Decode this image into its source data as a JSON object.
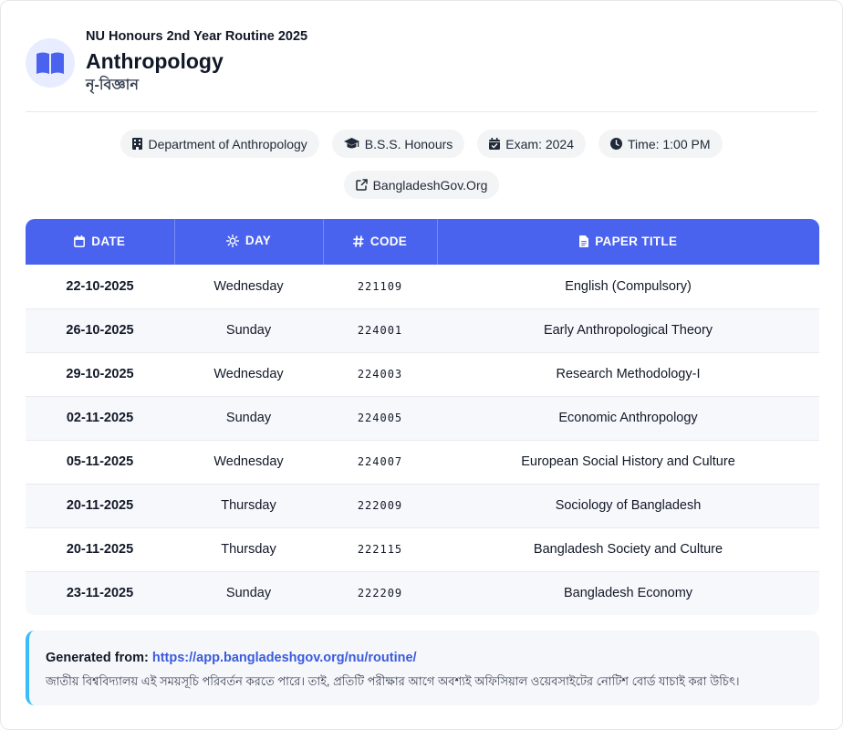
{
  "header": {
    "subtitle": "NU Honours 2nd Year Routine 2025",
    "title": "Anthropology",
    "bangla_title": "নৃ-বিজ্ঞান",
    "logo_icon": "book-open-icon"
  },
  "badges": [
    {
      "icon": "building-icon",
      "label": "Department of Anthropology"
    },
    {
      "icon": "graduation-cap-icon",
      "label": "B.S.S. Honours"
    },
    {
      "icon": "calendar-check-icon",
      "label": "Exam: 2024"
    },
    {
      "icon": "clock-icon",
      "label": "Time: 1:00 PM"
    },
    {
      "icon": "external-link-icon",
      "label": "BangladeshGov.Org"
    }
  ],
  "table": {
    "headers": {
      "date": "DATE",
      "day": "DAY",
      "code": "CODE",
      "title": "PAPER TITLE"
    },
    "rows": [
      {
        "date": "22-10-2025",
        "day": "Wednesday",
        "code": "221109",
        "title": "English (Compulsory)"
      },
      {
        "date": "26-10-2025",
        "day": "Sunday",
        "code": "224001",
        "title": "Early Anthropological Theory"
      },
      {
        "date": "29-10-2025",
        "day": "Wednesday",
        "code": "224003",
        "title": "Research Methodology-I"
      },
      {
        "date": "02-11-2025",
        "day": "Sunday",
        "code": "224005",
        "title": "Economic Anthropology"
      },
      {
        "date": "05-11-2025",
        "day": "Wednesday",
        "code": "224007",
        "title": "European Social History and Culture"
      },
      {
        "date": "20-11-2025",
        "day": "Thursday",
        "code": "222009",
        "title": "Sociology of Bangladesh"
      },
      {
        "date": "20-11-2025",
        "day": "Thursday",
        "code": "222115",
        "title": "Bangladesh Society and Culture"
      },
      {
        "date": "23-11-2025",
        "day": "Sunday",
        "code": "222209",
        "title": "Bangladesh Economy"
      }
    ]
  },
  "footer": {
    "generated_label": "Generated from:",
    "generated_url": "https://app.bangladeshgov.org/nu/routine/",
    "note": "জাতীয় বিশ্ববিদ্যালয় এই সময়সূচি পরিবর্তন করতে পারে। তাই, প্রতিটি পরীক্ষার আগে অবশ্যই অফিসিয়াল ওয়েবসাইটের নোটিশ বোর্ড যাচাই করা উচিৎ।"
  },
  "colors": {
    "accent": "#4a63ef",
    "link": "#3b5bdb",
    "footer_border": "#38bdf8",
    "logo_bg": "#e8ecff"
  }
}
